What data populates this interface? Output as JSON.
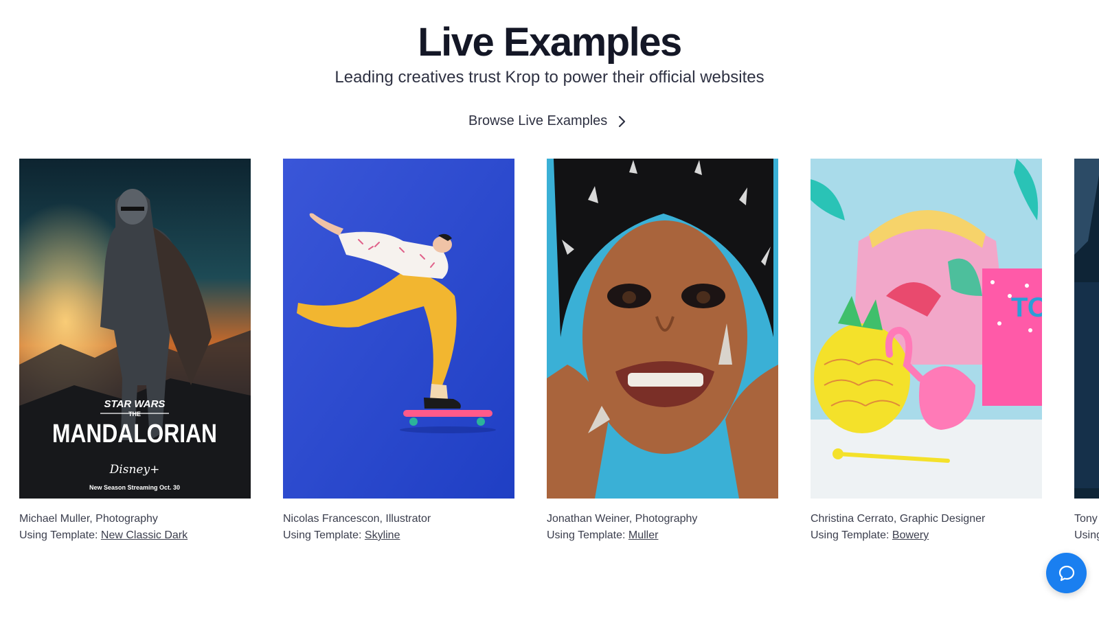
{
  "header": {
    "title": "Live Examples",
    "subtitle": "Leading creatives trust Krop to power their official websites",
    "browse_label": "Browse Live Examples"
  },
  "cards": [
    {
      "artist": "Michael Muller, Photography",
      "template_prefix": "Using Template:",
      "template_name": "New Classic Dark",
      "poster": {
        "line1": "STAR WARS",
        "line2": "THE",
        "line3": "MANDALORIAN",
        "brand": "Disney+",
        "tagline": "New Season Streaming Oct. 30"
      }
    },
    {
      "artist": "Nicolas Francescon, Illustrator",
      "template_prefix": "Using Template:",
      "template_name": "Skyline"
    },
    {
      "artist": "Jonathan Weiner, Photography",
      "template_prefix": "Using Template:",
      "template_name": "Muller"
    },
    {
      "artist": "Christina Cerrato, Graphic Designer",
      "template_prefix": "Using Template:",
      "template_name": "Bowery"
    },
    {
      "artist": "Tony",
      "template_prefix": "Using"
    }
  ],
  "icons": {
    "browse": "chevron-right-icon",
    "chat": "chat-bubble-icon"
  },
  "colors": {
    "heading": "#141726",
    "chat_button": "#1a7ff0",
    "skyline_bg": "#2b4fd0"
  }
}
